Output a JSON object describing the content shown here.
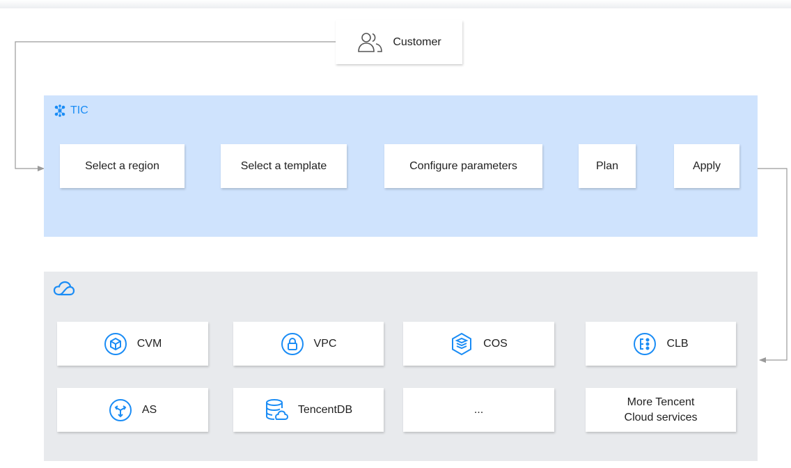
{
  "customer": {
    "label": "Customer",
    "icon": "users-icon"
  },
  "tic": {
    "label": "TIC",
    "icon": "tic-network-icon",
    "color": "#1a8cf5"
  },
  "steps": [
    {
      "label": "Select a region"
    },
    {
      "label": "Select a template"
    },
    {
      "label": "Configure parameters"
    },
    {
      "label": "Plan"
    },
    {
      "label": "Apply"
    }
  ],
  "cloud": {
    "icon": "tencent-cloud-icon"
  },
  "services": [
    {
      "label": "CVM",
      "icon": "cvm-icon"
    },
    {
      "label": "VPC",
      "icon": "vpc-icon"
    },
    {
      "label": "COS",
      "icon": "cos-icon"
    },
    {
      "label": "CLB",
      "icon": "clb-icon"
    },
    {
      "label": "AS",
      "icon": "as-icon"
    },
    {
      "label": "TencentDB",
      "icon": "tencentdb-icon"
    },
    {
      "label": "..."
    },
    {
      "label_line1": "More Tencent",
      "label_line2": "Cloud services"
    }
  ],
  "colors": {
    "accent": "#1a8cf5",
    "tic_panel": "#cfe3fd",
    "cloud_panel": "#e8eaed",
    "connector": "#9a9a9a"
  }
}
